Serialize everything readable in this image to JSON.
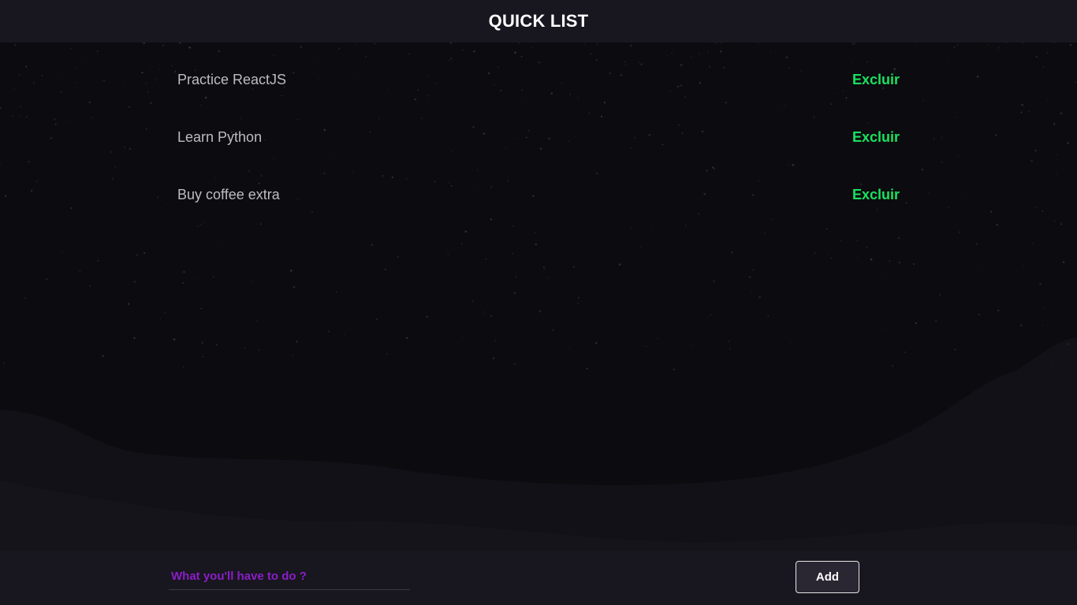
{
  "header": {
    "title": "QUICK LIST"
  },
  "tasks": [
    {
      "text": "Practice ReactJS",
      "delete_label": "Excluir"
    },
    {
      "text": "Learn Python",
      "delete_label": "Excluir"
    },
    {
      "text": "Buy coffee extra",
      "delete_label": "Excluir"
    }
  ],
  "footer": {
    "input_placeholder": "What you'll have to do ?",
    "input_value": "",
    "add_label": "Add"
  },
  "colors": {
    "background": "#0c0b0f",
    "bar": "#18161e",
    "accent_green": "#19e25e",
    "placeholder_purple": "#8a1ec8",
    "task_text": "#bdbcc3"
  }
}
